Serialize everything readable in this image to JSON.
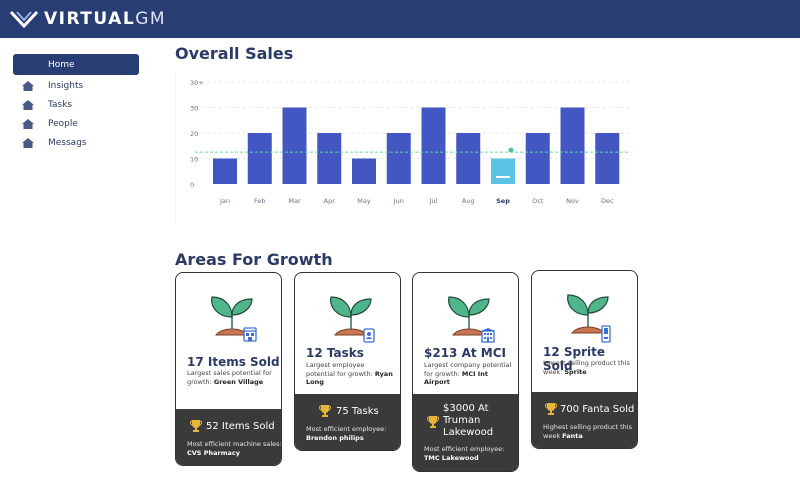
{
  "brand": {
    "name_main": "VIRTUAL",
    "name_accent": "GM"
  },
  "sidebar": {
    "items": [
      {
        "label": "Home",
        "icon": "home-icon",
        "active": true
      },
      {
        "label": "Insights",
        "icon": "home-icon",
        "active": false
      },
      {
        "label": "Tasks",
        "icon": "home-icon",
        "active": false
      },
      {
        "label": "People",
        "icon": "home-icon",
        "active": false
      },
      {
        "label": "Messags",
        "icon": "home-icon",
        "active": false
      }
    ]
  },
  "overall_sales": {
    "title": "Overall Sales"
  },
  "chart_data": {
    "type": "bar",
    "categories": [
      "Jan",
      "Feb",
      "Mar",
      "Apr",
      "May",
      "Jun",
      "Jul",
      "Aug",
      "Sep",
      "Oct",
      "Nov",
      "Dec"
    ],
    "values": [
      10,
      20,
      30,
      20,
      10,
      20,
      30,
      20,
      10,
      20,
      30,
      20
    ],
    "highlight_category": "Sep",
    "reference_line": 12.5,
    "y_ticks": [
      "0",
      "10",
      "20",
      "30",
      "30+"
    ],
    "ylim": [
      0,
      40
    ],
    "colors": {
      "bar": "#4257c2",
      "highlight": "#5bc3e6",
      "reference": "#6fd3a5"
    },
    "grid": true
  },
  "growth": {
    "title": "Areas For Growth",
    "cards": [
      {
        "title": "17 Items Sold",
        "desc_prefix": "Largest sales potential for growth: ",
        "desc_bold": "Green Village",
        "badge_icon": "store-icon",
        "bottom_title": "52 Items Sold",
        "bottom_desc_prefix": "Most efficient machine sales: ",
        "bottom_desc_bold": "CVS Pharmacy"
      },
      {
        "title": "12 Tasks",
        "desc_prefix": "Largest employee potential for growth: ",
        "desc_bold": "Ryan Long",
        "badge_icon": "id-badge-icon",
        "bottom_title": "75 Tasks",
        "bottom_desc_prefix": "Most efficient employee: ",
        "bottom_desc_bold": "Brendon philips"
      },
      {
        "title": "$213 At MCI",
        "desc_prefix": "Largest company potential for growth: ",
        "desc_bold": "MCI Int Airport",
        "badge_icon": "building-icon",
        "bottom_title": "$3000 At Truman Lakewood",
        "bottom_desc_prefix": "Most efficient employee: ",
        "bottom_desc_bold": "TMC Lakewood"
      },
      {
        "title": "12 Sprite Sold",
        "desc_prefix": "Lowest selling product this week: ",
        "desc_bold": "Sprite",
        "badge_icon": "vending-machine-icon",
        "bottom_title": "700 Fanta Sold",
        "bottom_desc_prefix": "Highest selling product this week ",
        "bottom_desc_bold": "Fanta"
      }
    ]
  }
}
